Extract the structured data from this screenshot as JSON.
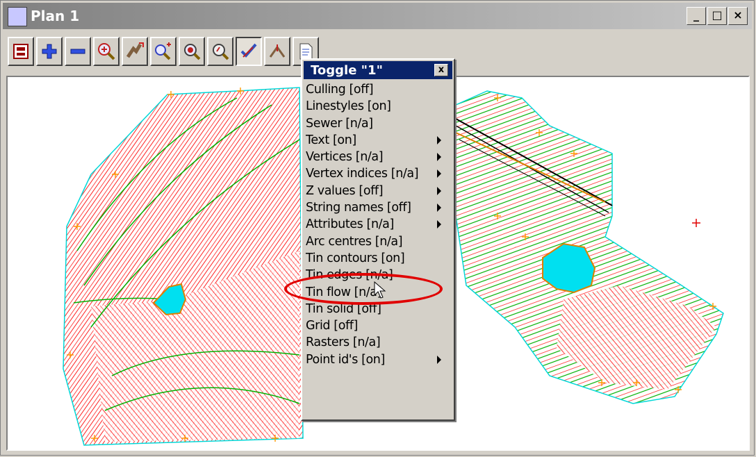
{
  "window": {
    "title": "Plan 1",
    "buttons": [
      "_",
      "□",
      "×"
    ]
  },
  "toolbar": {
    "buttons": [
      {
        "name": "plan-settings",
        "icon": "layers-icon"
      },
      {
        "name": "zoom-in",
        "icon": "plus-icon"
      },
      {
        "name": "zoom-out",
        "icon": "minus-icon"
      },
      {
        "name": "zoom-extent",
        "icon": "zoom-extent-icon"
      },
      {
        "name": "pan",
        "icon": "pan-hand-icon"
      },
      {
        "name": "zoom-window",
        "icon": "zoom-window-icon"
      },
      {
        "name": "zoom-centre",
        "icon": "zoom-centre-icon"
      },
      {
        "name": "zoom-search",
        "icon": "magnifier-icon"
      },
      {
        "name": "toggle",
        "icon": "toggle-icon"
      },
      {
        "name": "tracking",
        "icon": "tracking-icon"
      },
      {
        "name": "report",
        "icon": "document-icon"
      }
    ]
  },
  "menu": {
    "title": "Toggle \"1\"",
    "close": "x",
    "items": [
      {
        "label": "Culling [off]",
        "submenu": false
      },
      {
        "label": "Linestyles [on]",
        "submenu": false
      },
      {
        "label": "Sewer [n/a]",
        "submenu": false
      },
      {
        "label": "Text [on]",
        "submenu": true
      },
      {
        "label": "Vertices [n/a]",
        "submenu": true
      },
      {
        "label": "Vertex indices [n/a]",
        "submenu": true
      },
      {
        "label": "Z values [off]",
        "submenu": true
      },
      {
        "label": "String names [off]",
        "submenu": true
      },
      {
        "label": "Attributes [n/a]",
        "submenu": true
      },
      {
        "label": "Arc centres [n/a]",
        "submenu": false
      },
      {
        "label": "Tin contours [on]",
        "submenu": false
      },
      {
        "label": "Tin edges [n/a]",
        "submenu": false
      },
      {
        "label": "Tin flow [n/a]",
        "submenu": false
      },
      {
        "label": "Tin solid [off]",
        "submenu": false
      },
      {
        "label": "Grid [off]",
        "submenu": false
      },
      {
        "label": "Rasters [n/a]",
        "submenu": false
      },
      {
        "label": "Point id's [on]",
        "submenu": true
      }
    ]
  },
  "colors": {
    "contour_major": "#00c000",
    "contour_minor": "#ff0000",
    "boundary": "#00e0e0",
    "water": "#00e0f0",
    "vertex": "#ff9900",
    "annotation": "#e00000"
  }
}
